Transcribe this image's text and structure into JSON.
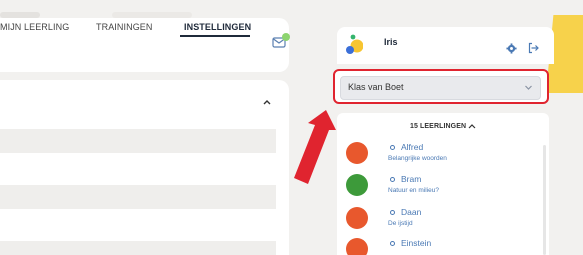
{
  "nav": {
    "items": [
      "MIJN LEERLING",
      "TRAININGEN",
      "INSTELLINGEN"
    ],
    "active_index": 2,
    "mail_badge": "0"
  },
  "user": {
    "name": "Iris"
  },
  "class_select": {
    "value": "Klas van Boet"
  },
  "students": {
    "header": "15 LEERLINGEN",
    "items": [
      {
        "name": "Alfred",
        "subtitle": "Belangrijke woorden",
        "avatar_color": "#e8582d"
      },
      {
        "name": "Bram",
        "subtitle": "Natuur en milieu?",
        "avatar_color": "#3d9a3a"
      },
      {
        "name": "Daan",
        "subtitle": "De ijstijd",
        "avatar_color": "#e8582d"
      },
      {
        "name": "Einstein",
        "subtitle": "",
        "avatar_color": "#e8582d"
      }
    ]
  },
  "colors": {
    "accent_red": "#e0242f",
    "link_blue": "#4a79b4",
    "yellow_accent": "#f7d24b",
    "badge_green": "#8dd46f"
  },
  "icons": [
    "mail-icon",
    "chevron-up-icon",
    "gear-icon",
    "logout-icon",
    "chevron-down-icon",
    "red-arrow-annotation"
  ]
}
